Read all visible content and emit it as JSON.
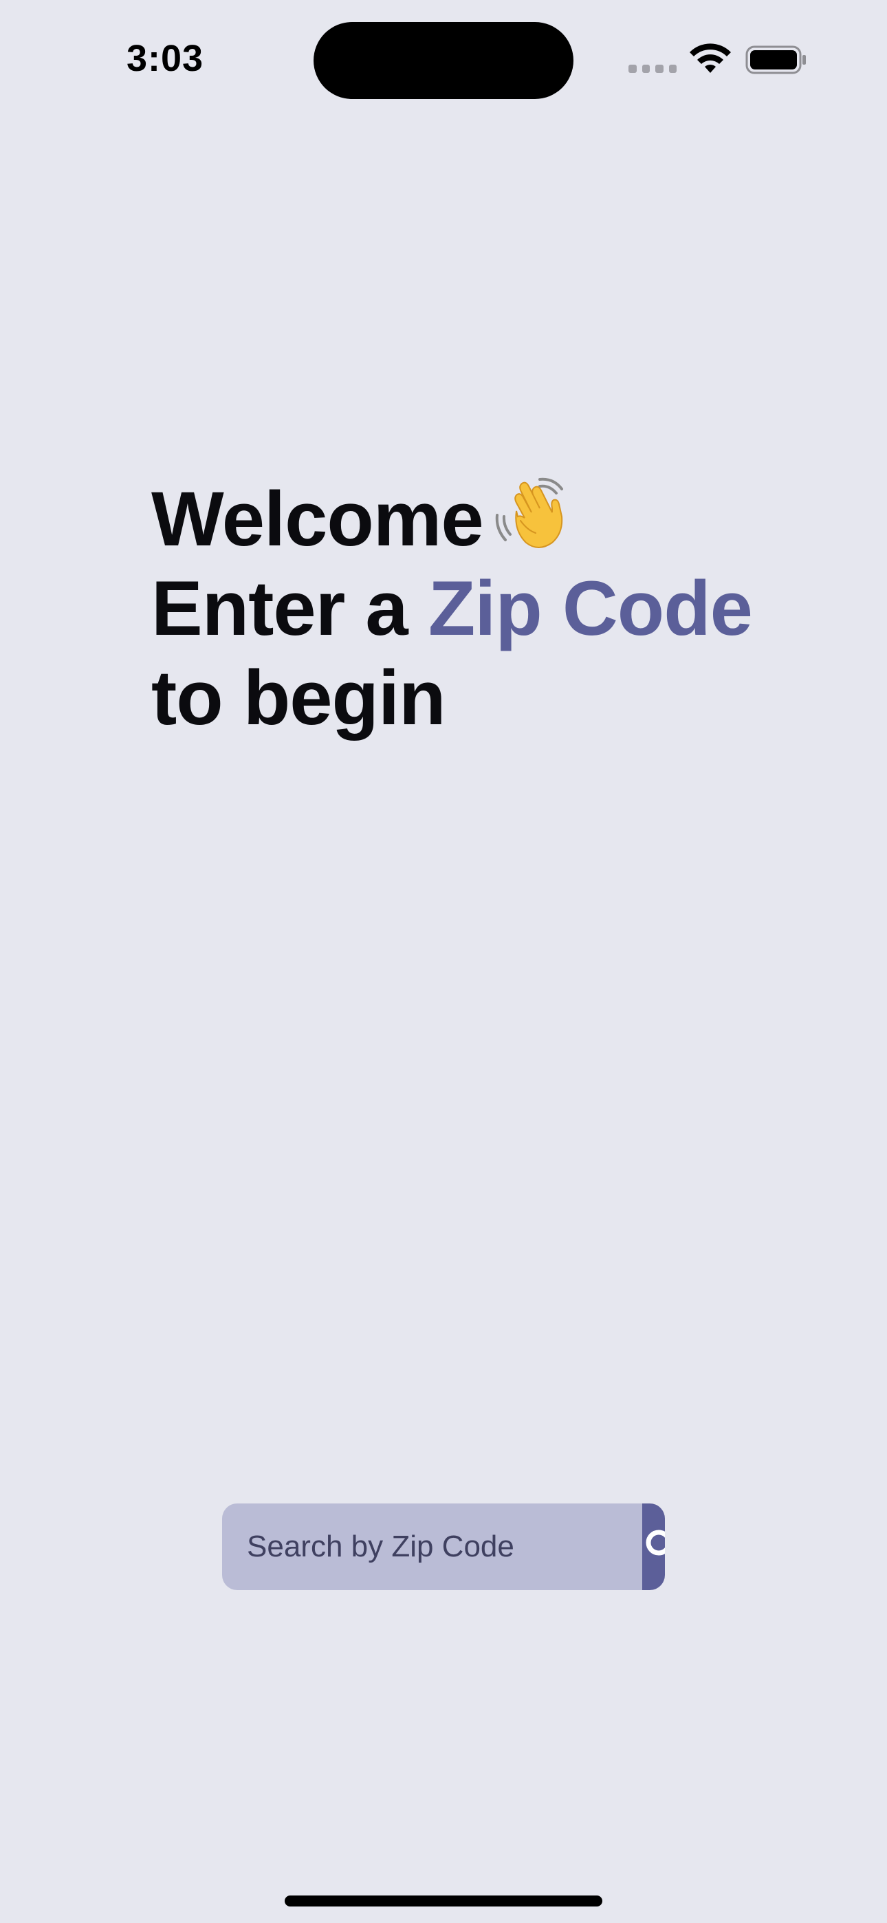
{
  "status_bar": {
    "time": "3:03",
    "icons": [
      "cellular-signal-icon",
      "wifi-icon",
      "battery-icon"
    ]
  },
  "headline": {
    "line1": "Welcome",
    "line1_emoji_icon": "waving-hand-icon",
    "line2_prefix": "Enter a",
    "line2_highlight": "Zip Code",
    "line3": "to begin"
  },
  "search": {
    "placeholder": "Search by Zip Code",
    "value": "",
    "button_icon": "search-icon"
  },
  "colors": {
    "background": "#e6e7ef",
    "accent": "#5b5f99",
    "input_background": "#babcd6",
    "text": "#0b0b0f"
  }
}
